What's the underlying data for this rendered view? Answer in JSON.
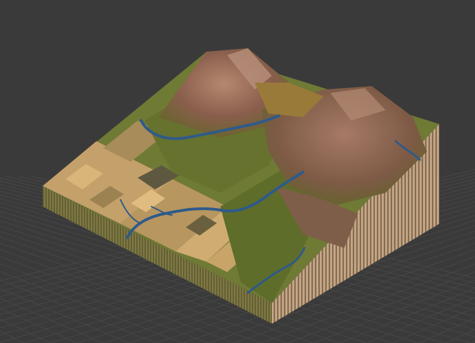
{
  "viewport": {
    "background": "#3a3a3a",
    "grid_color": "#474747",
    "show_grid": true,
    "projection": "isometric-perspective"
  },
  "terrain": {
    "colors": {
      "mountain_rock": "#8a5e4c",
      "mountain_highlight": "#b07e68",
      "foothill": "#6b6430",
      "grass": "#6f7a35",
      "grass_dark": "#4f5a25",
      "fields_tan": "#c4a06a",
      "fields_light": "#d9b57a",
      "fields_dark": "#5e5840",
      "river": "#2e5a8a",
      "side_base": "#8a7a52"
    }
  }
}
